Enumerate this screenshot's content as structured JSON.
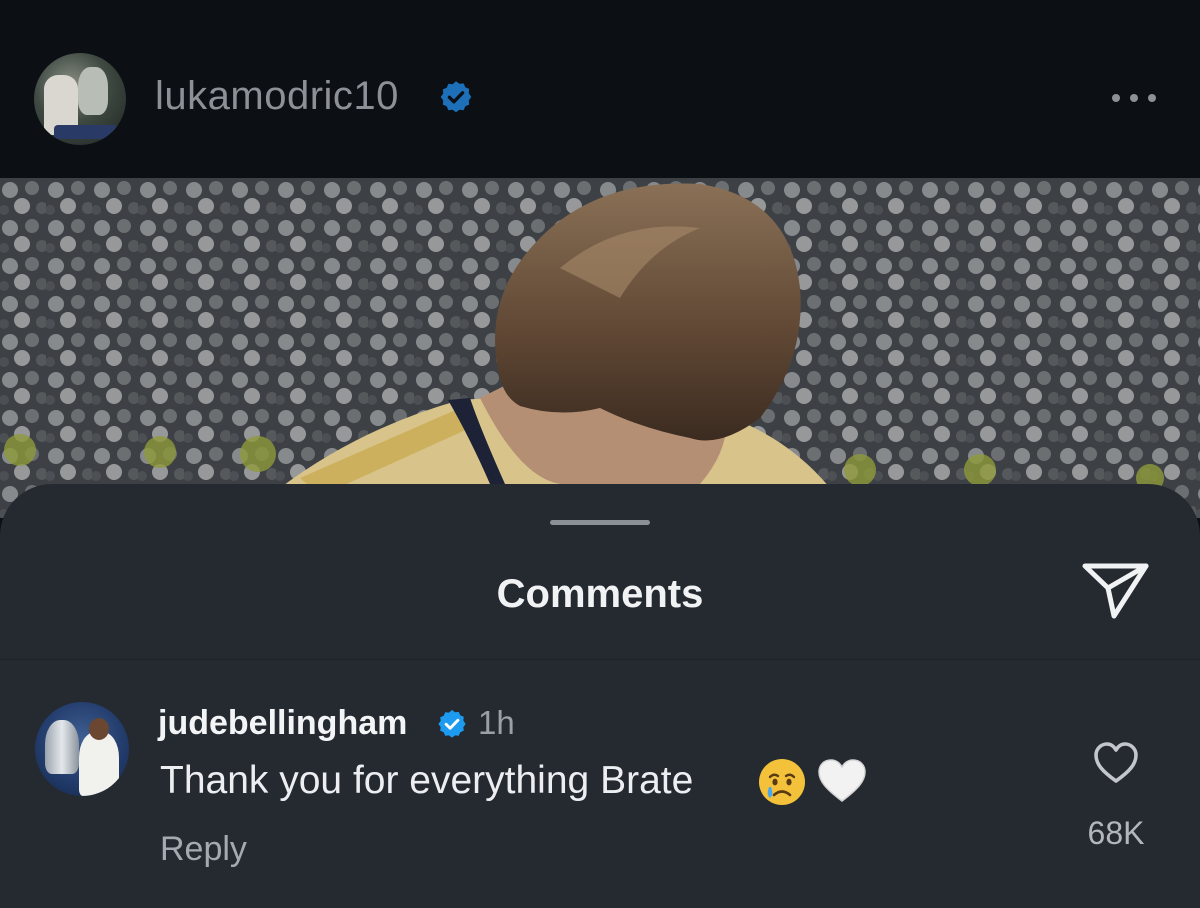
{
  "post": {
    "username": "lukamodric10",
    "verified": true,
    "avatar_icon": "profile-photo",
    "more_icon": "more-horizontal-icon"
  },
  "sheet": {
    "title": "Comments",
    "share_icon": "paper-plane-icon"
  },
  "comments": [
    {
      "username": "judebellingham",
      "verified": true,
      "time": "1h",
      "text": "Thank you for everything Brate",
      "emojis": [
        "crying-face",
        "white-heart"
      ],
      "reply_label": "Reply",
      "like_count": "68K"
    }
  ],
  "colors": {
    "background": "#0c0f14",
    "sheet": "#252a31",
    "verified_blue": "#1d9bf0",
    "primary_text": "#f1f2f4",
    "secondary_text": "#9ca0a6"
  }
}
